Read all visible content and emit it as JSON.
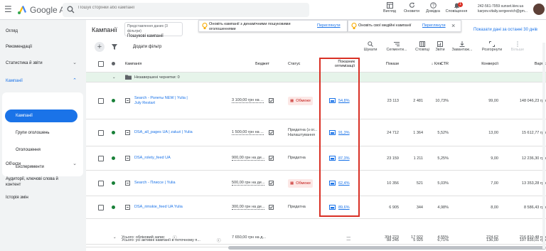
{
  "header": {
    "app_name": "Google Ads",
    "search_placeholder": "Пошук сторінки або кампанії",
    "tools": [
      {
        "label": "Вигляд",
        "icon": "view-icon"
      },
      {
        "label": "Оновити",
        "icon": "refresh-icon"
      },
      {
        "label": "Довідка",
        "icon": "help-icon"
      },
      {
        "label": "Сповіщення",
        "icon": "bell-icon"
      }
    ],
    "notification_count": "1",
    "account_id": "242-561-7959 sunset.kiev.ua",
    "account_email": "karpov.vitaliy.sergeevich@gm..."
  },
  "sidebar": {
    "overview": "Огляд",
    "recommendations": "Рекомендації",
    "stats": "Статистика й звіти",
    "campaigns": "Кампанії",
    "campaigns_sub": [
      "Кампанії",
      "Групи оголошень",
      "Оголошення",
      "Експерименти"
    ],
    "objects": "Об'єкти",
    "audiences": "Аудиторії, ключові слова й контент",
    "history": "Історія змін"
  },
  "page": {
    "title": "Кампанії",
    "view_label": "Представлення даних (3 фільтри)",
    "view_value": "Пошукові кампанії",
    "notif1_text": "Оновіть кампанії з динамічними пошуковими оголошеннями",
    "notif1_action": "Переглянути",
    "notif2_text": "Оновіть свої медійні кампанії",
    "notif2_action": "Переглянути",
    "date_range": "Показати дані за останні 30 днів"
  },
  "toolbar": {
    "add_filter": "Додати фільтр",
    "tools": [
      "Шукати",
      "Сегменти...",
      "Стовпці",
      "Звіти",
      "Завантаж...",
      "Розгорнути",
      "Більше"
    ]
  },
  "table": {
    "headers": {
      "campaign": "Кампанія",
      "budget": "Бюджет",
      "status": "Статус",
      "optimization": "Показник оптимізації",
      "impressions": "Покази",
      "clicks": "Клік",
      "ctr": "CTR",
      "conversions": "Конверсії",
      "cost": "Вартіс"
    },
    "draft_row": "Незавершені чернетки: 0",
    "rows": [
      {
        "campaign": "Search - Ролеты NEW | Yulia | July Restart",
        "budget": "3 100,00 грн на ...",
        "status": "Обмеже",
        "status_type": "limited",
        "opt": "54,8%",
        "impressions": "23 113",
        "clicks": "2 481",
        "ctr": "10,73%",
        "conversions": "99,00",
        "cost": "148 046,23 грн"
      },
      {
        "campaign": "DSA_all_pages UA | zaluzi | Yulia",
        "budget": "1 500,00 грн на ...",
        "status": "Придатна (з ог... Налаштування",
        "status_type": "eligible",
        "opt": "91,3%",
        "impressions": "24 712",
        "clicks": "1 364",
        "ctr": "5,52%",
        "conversions": "13,00",
        "cost": "15 612,77 грн"
      },
      {
        "campaign": "DSA_rolety_feed UA",
        "budget": "900,00 грн на де...",
        "status": "Придатна",
        "status_type": "eligible",
        "opt": "87,3%",
        "impressions": "23 159",
        "clicks": "1 211",
        "ctr": "5,25%",
        "conversions": "9,00",
        "cost": "12 236,30 грн"
      },
      {
        "campaign": "Search - Плиссе | Yulia",
        "budget": "500,00 грн на де...",
        "status": "Обмеже",
        "status_type": "limited",
        "opt": "62,4%",
        "impressions": "10 356",
        "clicks": "521",
        "ctr": "5,03%",
        "conversions": "7,00",
        "cost": "13 353,28 грн"
      },
      {
        "campaign": "DSA_rimskie_feed UA Yulia",
        "budget": "300,00 грн на де...",
        "status": "Придатна",
        "status_type": "eligible",
        "opt": "89,6%",
        "impressions": "6 905",
        "clicks": "344",
        "ctr": "4,98%",
        "conversions": "8,00",
        "cost": "8 586,43 грн"
      }
    ],
    "total_active": {
      "label": "Усього: усі активні кампанії в поточному п...",
      "opt": "—",
      "impressions": "88 245",
      "clicks": "5 925",
      "ctr": "6,71%",
      "conversions": "136,00",
      "cost": "197 835,01 грн"
    },
    "total_account": {
      "label": "Усього: обліковий запис",
      "budget": "7 650,00 грн на д...",
      "opt": "—",
      "impressions": "394 223",
      "clicks": "17 922",
      "ctr": "4,55%",
      "conversions": "224,62",
      "cost": "216 810,48 грн"
    }
  }
}
